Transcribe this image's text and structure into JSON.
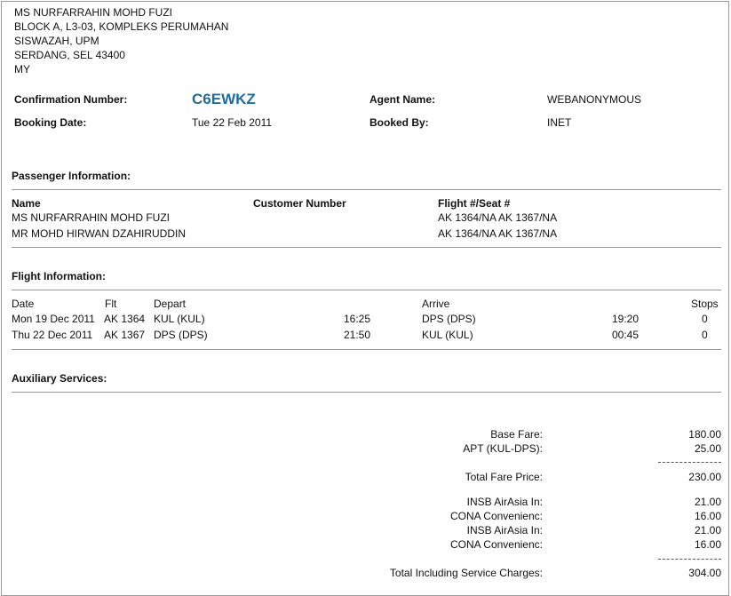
{
  "address": {
    "line1": "MS NURFARRAHIN MOHD FUZI",
    "line2": "BLOCK A, L3-03, KOMPLEKS PERUMAHAN",
    "line3": "SISWAZAH, UPM",
    "line4": "SERDANG, SEL 43400",
    "line5": "MY"
  },
  "booking": {
    "confirmation_label": "Confirmation Number:",
    "confirmation_value": "C6EWKZ",
    "agent_label": "Agent Name:",
    "agent_value": "WEBANONYMOUS",
    "date_label": "Booking Date:",
    "date_value": "Tue 22 Feb 2011",
    "booked_by_label": "Booked By:",
    "booked_by_value": "INET"
  },
  "passengers": {
    "title": "Passenger Information:",
    "headers": {
      "name": "Name",
      "customer": "Customer Number",
      "flight_seat": "Flight #/Seat #"
    },
    "rows": [
      {
        "name": "MS NURFARRAHIN MOHD FUZI",
        "flight_seat": "AK 1364/NA AK 1367/NA"
      },
      {
        "name": "MR MOHD HIRWAN DZAHIRUDDIN",
        "flight_seat": "AK 1364/NA AK 1367/NA"
      }
    ]
  },
  "flights": {
    "title": "Flight Information:",
    "headers": {
      "date": "Date",
      "flt": "Flt",
      "depart": "Depart",
      "arrive": "Arrive",
      "stops": "Stops"
    },
    "rows": [
      {
        "date": "Mon 19 Dec 2011",
        "flt": "AK 1364",
        "depart": "KUL (KUL)",
        "depart_time": "16:25",
        "arrive": "DPS (DPS)",
        "arrive_time": "19:20",
        "stops": "0"
      },
      {
        "date": "Thu 22 Dec 2011",
        "flt": "AK 1367",
        "depart": "DPS (DPS)",
        "depart_time": "21:50",
        "arrive": "KUL (KUL)",
        "arrive_time": "00:45",
        "stops": "0"
      }
    ]
  },
  "auxiliary": {
    "title": "Auxiliary Services:"
  },
  "fares": {
    "base_label": "Base Fare:",
    "base_value": "180.00",
    "apt_label": "APT (KUL-DPS):",
    "apt_value": "25.00",
    "total_fare_label": "Total Fare Price:",
    "total_fare_value": "230.00",
    "charges": [
      {
        "label": "INSB AirAsia In:",
        "value": "21.00"
      },
      {
        "label": "CONA Convenienc:",
        "value": "16.00"
      },
      {
        "label": "INSB AirAsia In:",
        "value": "21.00"
      },
      {
        "label": "CONA Convenienc:",
        "value": "16.00"
      }
    ],
    "grand_total_label": "Total Including Service Charges:",
    "grand_total_value": "304.00"
  }
}
